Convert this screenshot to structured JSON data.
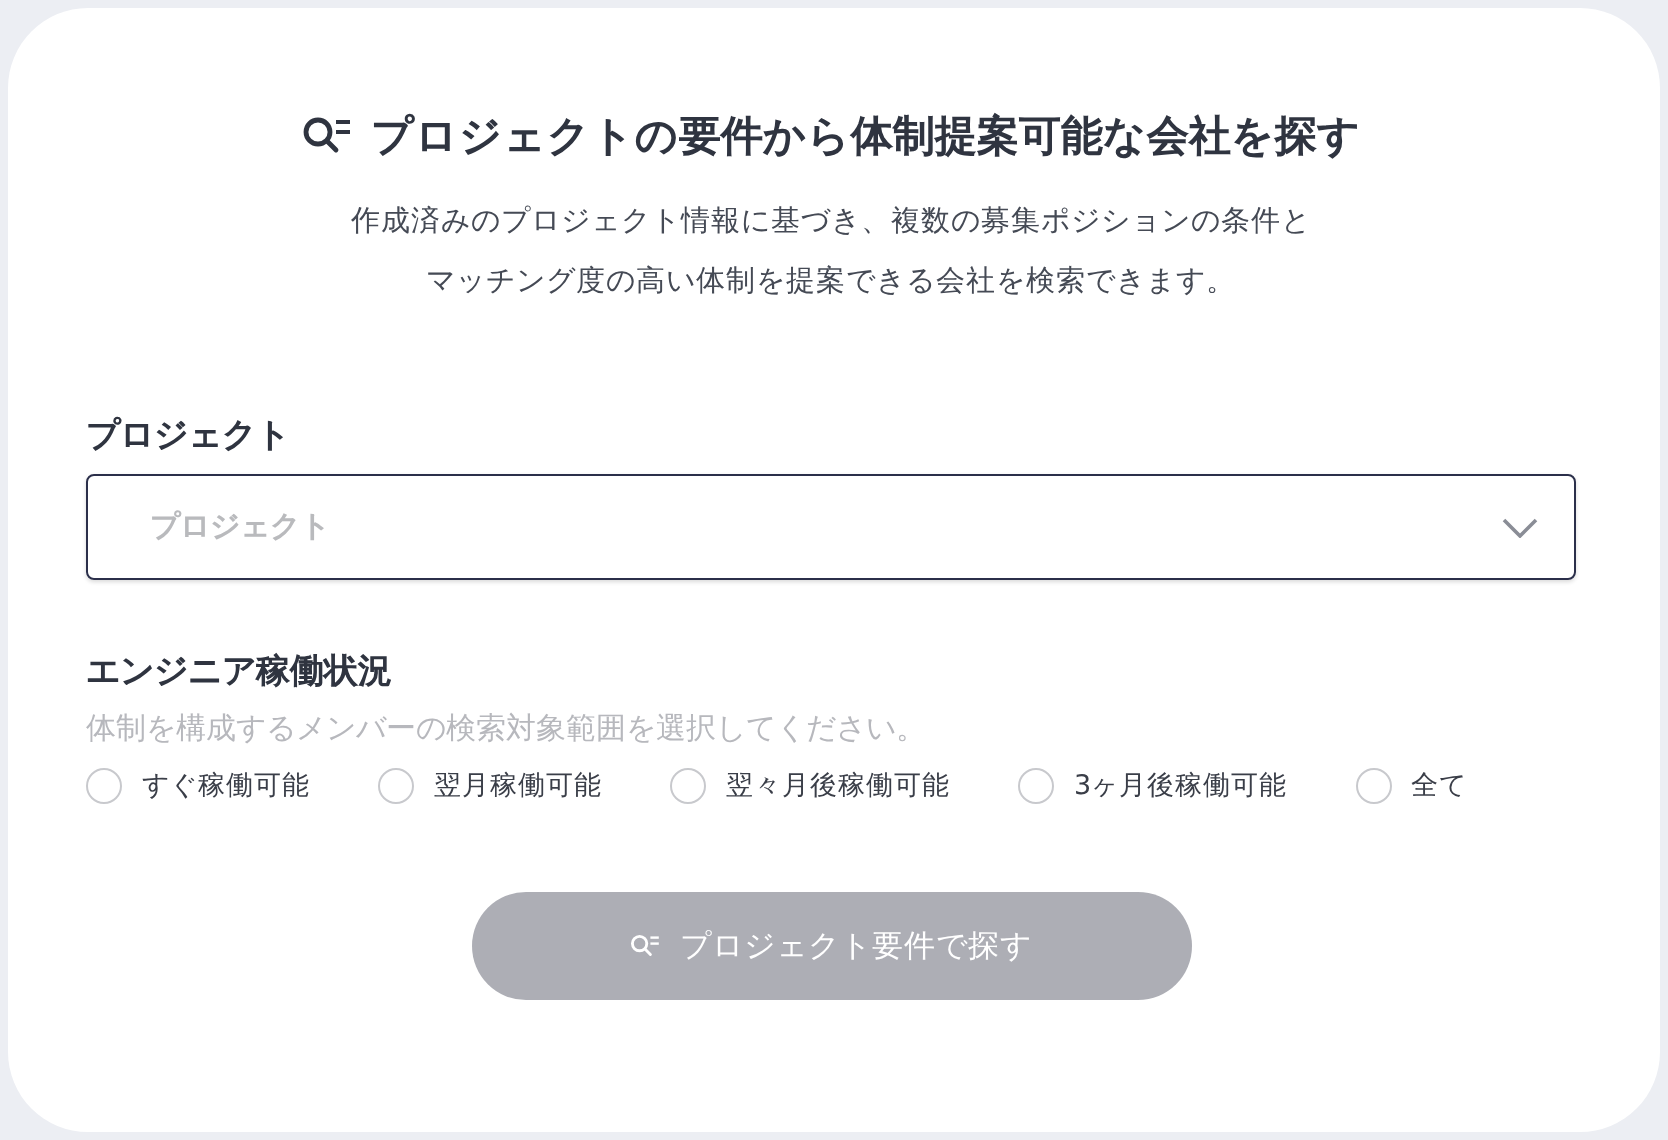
{
  "title": "プロジェクトの要件から体制提案可能な会社を探す",
  "description": [
    "作成済みのプロジェクト情報に基づき、複数の募集ポジションの条件と",
    "マッチング度の高い体制を提案できる会社を検索できます。"
  ],
  "project_field": {
    "label": "プロジェクト",
    "placeholder": "プロジェクト"
  },
  "availability": {
    "label": "エンジニア稼働状況",
    "hint": "体制を構成するメンバーの検索対象範囲を選択してください。",
    "options": [
      {
        "label": "すぐ稼働可能",
        "selected": false
      },
      {
        "label": "翌月稼働可能",
        "selected": false
      },
      {
        "label": "翌々月後稼働可能",
        "selected": false
      },
      {
        "label": "3ヶ月後稼働可能",
        "selected": false
      },
      {
        "label": "全て",
        "selected": false
      }
    ]
  },
  "search_button": {
    "label": "プロジェクト要件で探す",
    "disabled": true
  }
}
